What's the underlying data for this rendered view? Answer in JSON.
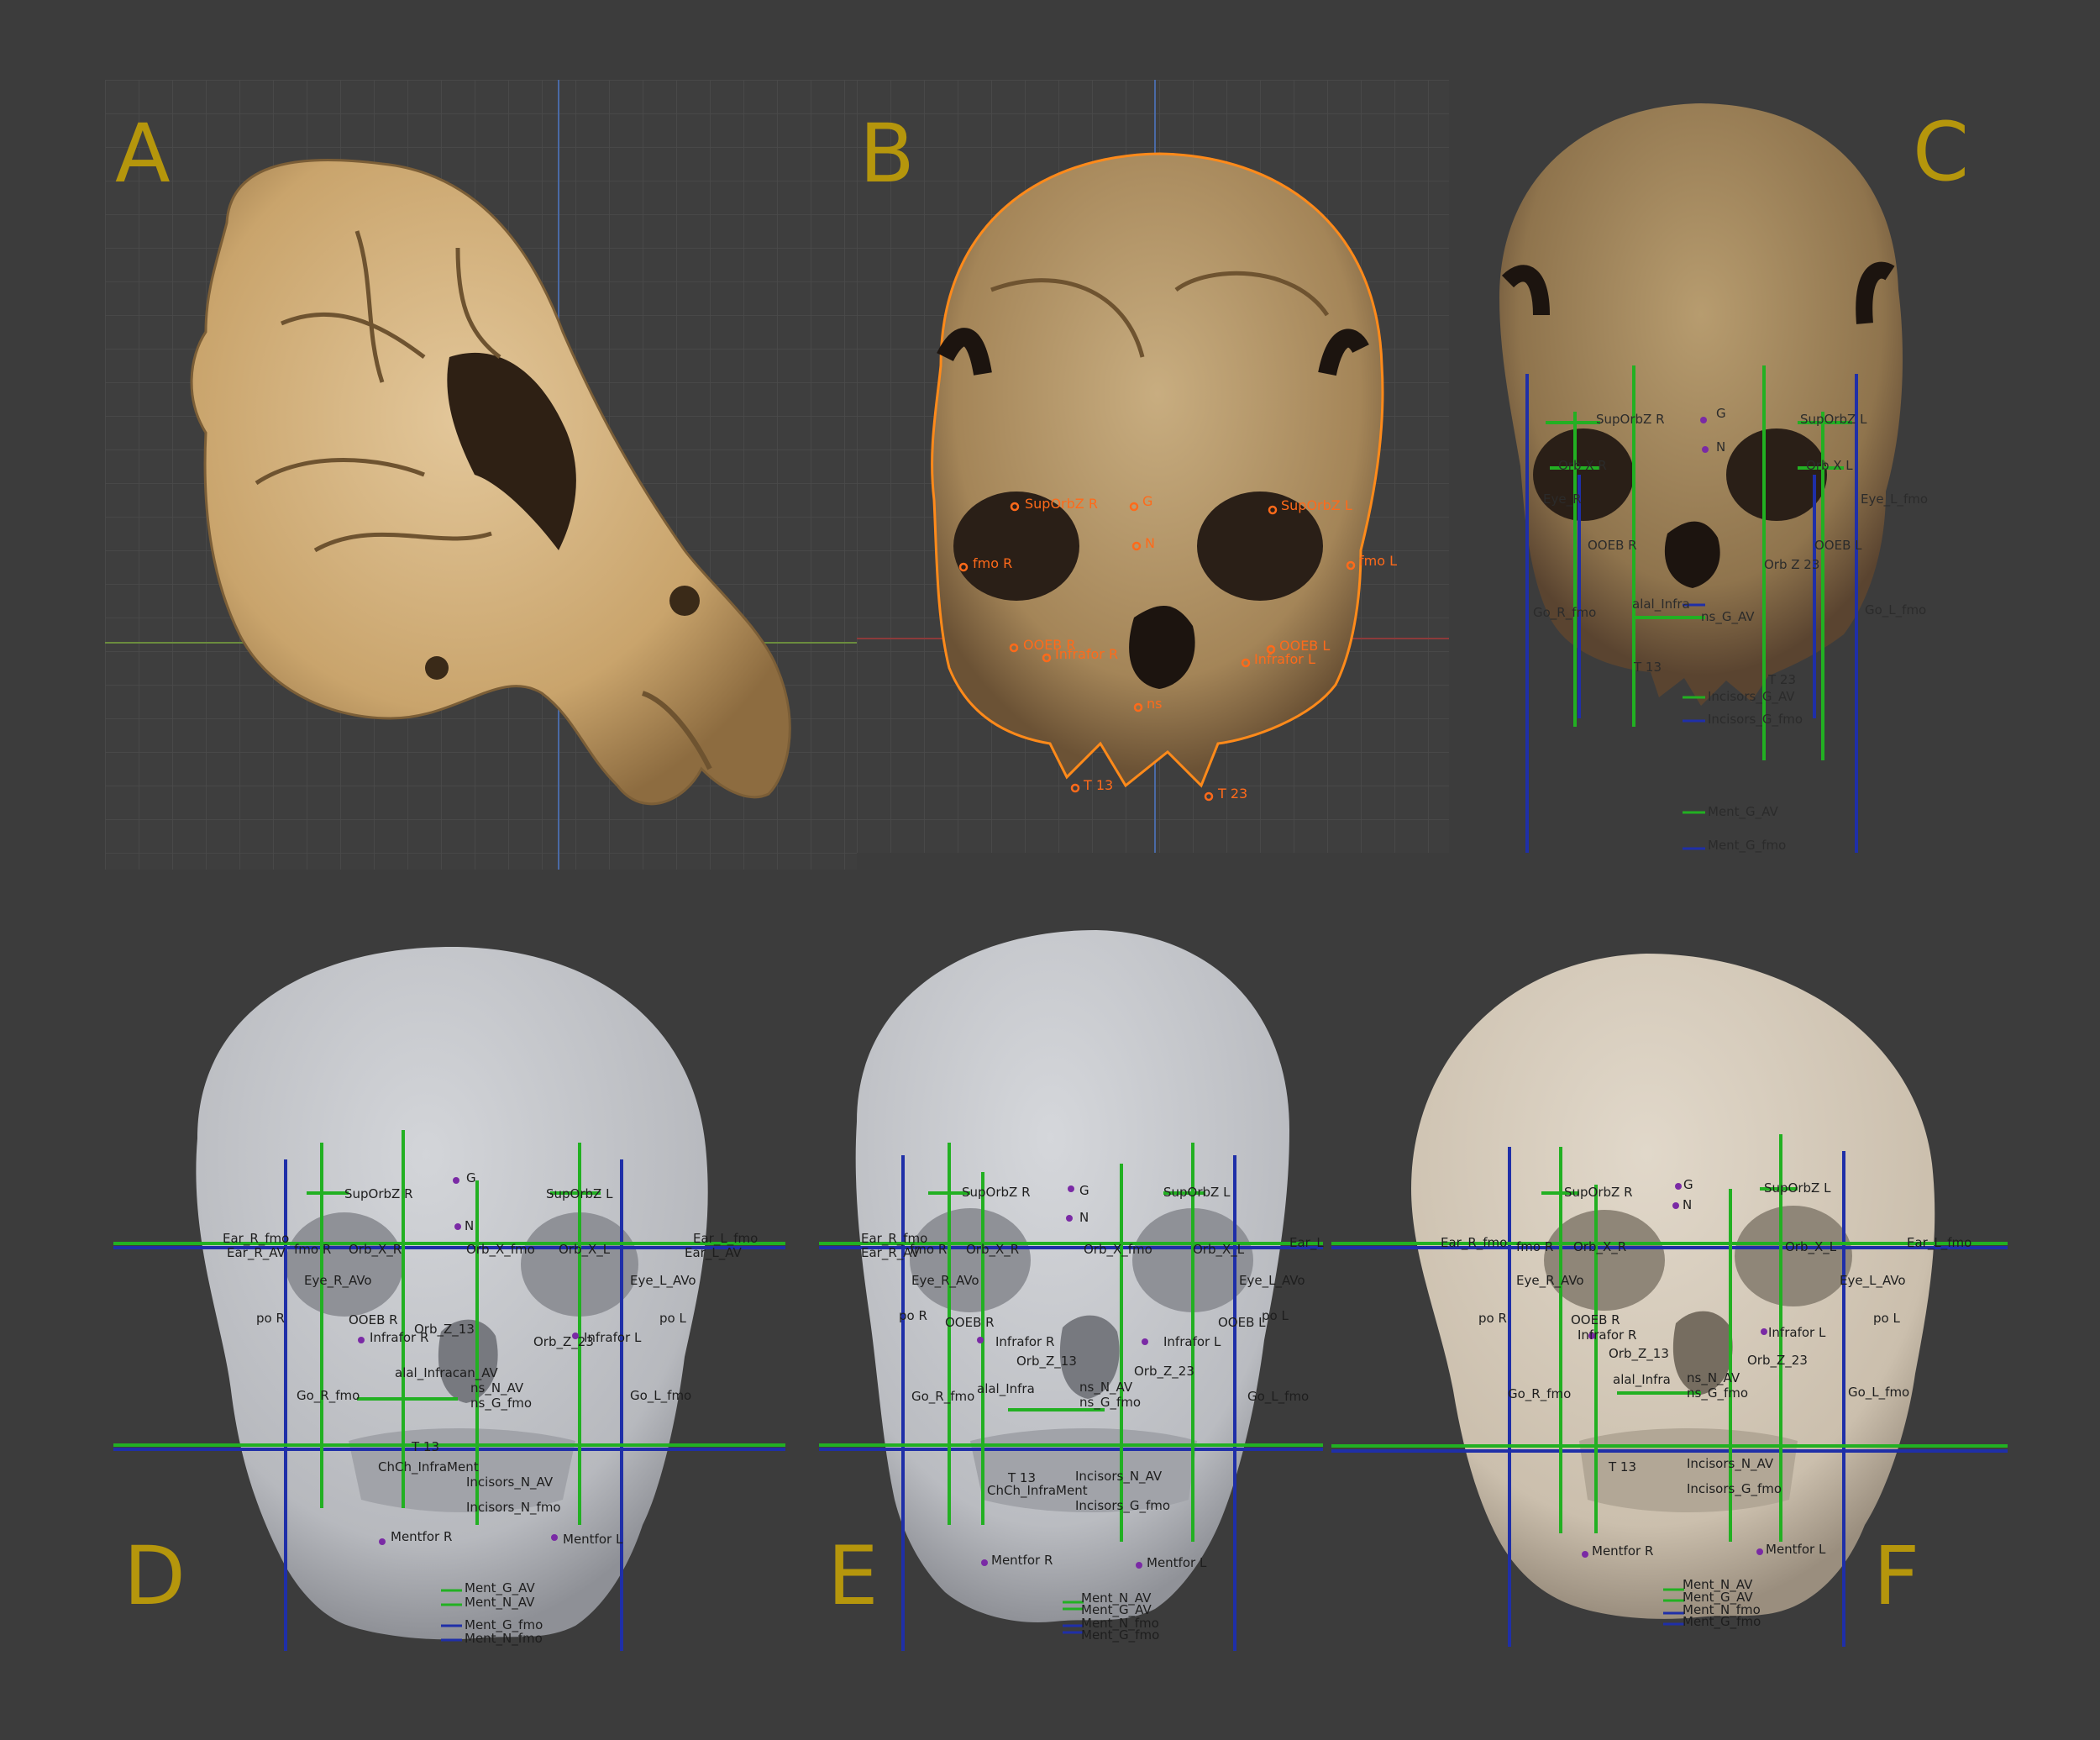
{
  "panels": {
    "A": {
      "letter": "A"
    },
    "B": {
      "letter": "B",
      "landmarks": {
        "supOrbZ_R": "SupOrbZ R",
        "g": "G",
        "supOrbZ_L": "SupOrbZ L",
        "n": "N",
        "fmo_R": "fmo R",
        "fmo_L": "fmo L",
        "ooeb_R": "OOEB R",
        "infrafor_R": "Infrafor R",
        "ooeb_L": "OOEB L",
        "infrafor_L": "Infrafor L",
        "ns": "ns",
        "t13": "T 13",
        "t23": "T 23"
      }
    },
    "C": {
      "letter": "C",
      "labels": {
        "supOrbZ_R": "SupOrbZ R",
        "g": "G",
        "supOrbZ_L": "SupOrbZ L",
        "n": "N",
        "orbX_R": "Orb X R",
        "orbX_L": "Orb X L",
        "eye_R": "Eye_R",
        "eye_L": "Eye_L_fmo",
        "ooeb_R": "OOEB R",
        "ooeb_L": "OOEB L",
        "orbZ": "Orb Z 23",
        "alal": "alal_Infra",
        "ns_av": "ns_G_AV",
        "go_R": "Go_R_fmo",
        "go_L": "Go_L_fmo",
        "t13": "T 13",
        "t23": "T 23",
        "incisors_av": "Incisors_G_AV",
        "incisors_fmo": "Incisors_G_fmo",
        "ment_av": "Ment_G_AV",
        "ment_fmo": "Ment_G_fmo"
      }
    },
    "D": {
      "letter": "D",
      "labels": {
        "supOrbZ_R": "SupOrbZ R",
        "supOrbZ_L": "SupOrbZ L",
        "g": "G",
        "n": "N",
        "ear_R_fmo": "Ear_R_fmo",
        "ear_R_av": "Ear_R_AV",
        "ear_L_fmo": "Ear_L_fmo",
        "ear_L_av": "Ear_L_AV",
        "fmo_R": "fmo R",
        "orbX_R": "Orb_X_R",
        "orbX_fmo": "Orb_X_fmo",
        "orbX_L": "Orb_X_L",
        "eye_R": "Eye_R_AVo",
        "eye_L": "Eye_L_AVo",
        "po_R": "po R",
        "po_L": "po L",
        "ooeb_R": "OOEB R",
        "infrafor_R": "Infrafor R",
        "orbZ13": "Orb_Z_13",
        "orbZ23": "Orb_Z_23",
        "infrafor_L": "Infrafor L",
        "alal": "alal_Infracan_AV",
        "ns_av": "ns_N_AV",
        "ns_fmo": "ns_G_fmo",
        "go_R": "Go_R_fmo",
        "go_L": "Go_L_fmo",
        "t13": "T 13",
        "chch": "ChCh_InfraMent",
        "incisors_av": "Incisors_N_AV",
        "incisors_fmo": "Incisors_N_fmo",
        "mentfor_R": "Mentfor R",
        "mentfor_L": "Mentfor L",
        "ment_g_av": "Ment_G_AV",
        "ment_n_av": "Ment_N_AV",
        "ment_g_fmo": "Ment_G_fmo",
        "ment_n_fmo": "Ment_N_fmo"
      }
    },
    "E": {
      "letter": "E",
      "labels": {
        "supOrbZ_R": "SupOrbZ R",
        "supOrbZ_L": "SupOrbZ L",
        "g": "G",
        "n": "N",
        "ear_R_fmo": "Ear_R_fmo",
        "ear_R_av": "Ear_R_AV",
        "ear_L": "Ear_L",
        "fmo_R": "fmo R",
        "orbX_R": "Orb_X_R",
        "orbX_fmo": "Orb_X_fmo",
        "orbX_L": "Orb_X_L",
        "eye_R": "Eye_R_AVo",
        "eye_L": "Eye_L_AVo",
        "po_R": "po R",
        "po_L": "po L",
        "ooeb_R": "OOEB R",
        "ooeb_L": "OOEB L",
        "infrafor_R": "Infrafor R",
        "infrafor_L": "Infrafor L",
        "orbZ13": "Orb_Z_13",
        "orbZ23": "Orb_Z_23",
        "alal": "alal_Infra",
        "ns_av": "ns_N_AV",
        "ns_fmo": "ns_G_fmo",
        "go_R": "Go_R_fmo",
        "go_L": "Go_L_fmo",
        "t13": "T 13",
        "chch": "ChCh_InfraMent",
        "incisors_av": "Incisors_N_AV",
        "incisors_fmo": "Incisors_G_fmo",
        "mentfor_R": "Mentfor R",
        "mentfor_L": "Mentfor L",
        "ment_n_av": "Ment_N_AV",
        "ment_g_av": "Ment_G_AV",
        "ment_n_fmo": "Ment_N_fmo",
        "ment_g_fmo": "Ment_G_fmo"
      }
    },
    "F": {
      "letter": "F",
      "labels": {
        "supOrbZ_R": "SupOrbZ R",
        "supOrbZ_L": "SupOrbZ L",
        "g": "G",
        "n": "N",
        "ear_R": "Ear_R_fmo",
        "ear_L": "Ear_L_fmo",
        "fmo_R": "fmo R",
        "orbX_R": "Orb_X_R",
        "orbX_L": "Orb_X_L",
        "eye_R": "Eye_R_AVo",
        "eye_L": "Eye_L_AVo",
        "po_R": "po R",
        "po_L": "po L",
        "ooeb_R": "OOEB R",
        "infrafor_R": "Infrafor R",
        "infrafor_L": "Infrafor L",
        "orbZ13": "Orb_Z_13",
        "orbZ23": "Orb_Z_23",
        "alal": "alal_Infra",
        "ns_av": "ns_N_AV",
        "ns_fmo": "ns_G_fmo",
        "go_R": "Go_R_fmo",
        "go_L": "Go_L_fmo",
        "t13": "T 13",
        "incisors_av": "Incisors_N_AV",
        "incisors_fmo": "Incisors_G_fmo",
        "mentfor_R": "Mentfor R",
        "mentfor_L": "Mentfor L",
        "ment_n_av": "Ment_N_AV",
        "ment_g_av": "Ment_G_AV",
        "ment_n_fmo": "Ment_N_fmo",
        "ment_g_fmo": "Ment_G_fmo"
      }
    }
  },
  "colors": {
    "background": "#3c3c3c",
    "viewport": "#3e3e3e",
    "grid": "#4c4c4c",
    "letter": "#b5960c",
    "bone_scan": "#c9a777",
    "bone_dark": "#8a7048",
    "gray_model": "#c4c6cb",
    "beige_model": "#d9cfbf",
    "guide_green": "#22b022",
    "guide_blue": "#1f2fa8",
    "landmark_orange": "#ff6a1a",
    "landmark_purple": "#7a2aa5"
  }
}
